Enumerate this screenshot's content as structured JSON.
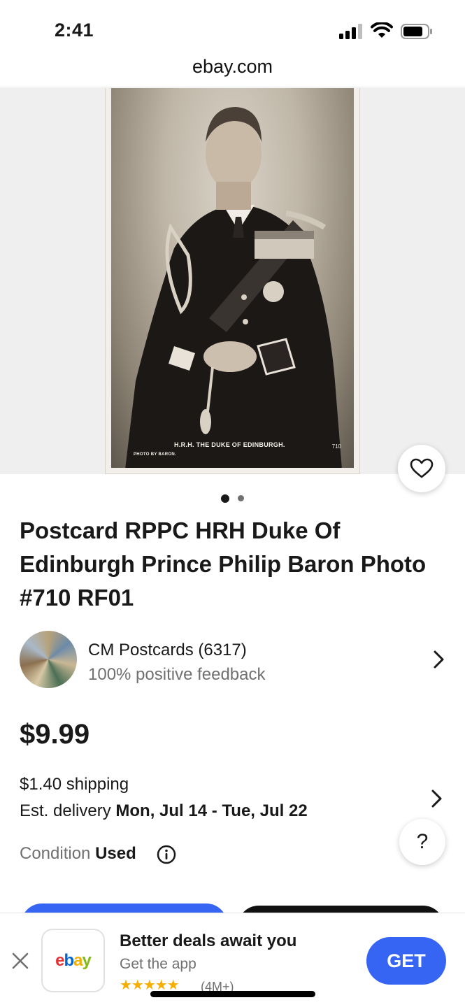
{
  "status_bar": {
    "time": "2:41"
  },
  "browser": {
    "url": "ebay.com"
  },
  "photo": {
    "caption": "H.R.H. THE DUKE OF EDINBURGH.",
    "credit": "PHOTO BY BARON.",
    "number": "710"
  },
  "gallery": {
    "current_index": 1,
    "total": 2
  },
  "listing": {
    "title": "Postcard RPPC HRH Duke Of Edinburgh Prince Philip Baron Photo #710 RF01",
    "price": "$9.99",
    "shipping": "$1.40 shipping",
    "delivery_label": "Est. delivery ",
    "delivery_dates": "Mon, Jul 14 - Tue, Jul 22",
    "condition_label": "Condition ",
    "condition_value": "Used"
  },
  "seller": {
    "name": "CM Postcards (6317)",
    "feedback": "100% positive feedback"
  },
  "help": {
    "label": "?"
  },
  "app_banner": {
    "title": "Better deals await you",
    "subtitle": "Get the app",
    "stars": "★★★★★",
    "rating_count": "(4M+)",
    "get_label": "GET",
    "logo": {
      "e": "e",
      "b": "b",
      "a": "a",
      "y": "y"
    }
  },
  "colors": {
    "accent_blue": "#3665f3",
    "text": "#191919",
    "muted": "#707070",
    "star": "#f5af02"
  }
}
